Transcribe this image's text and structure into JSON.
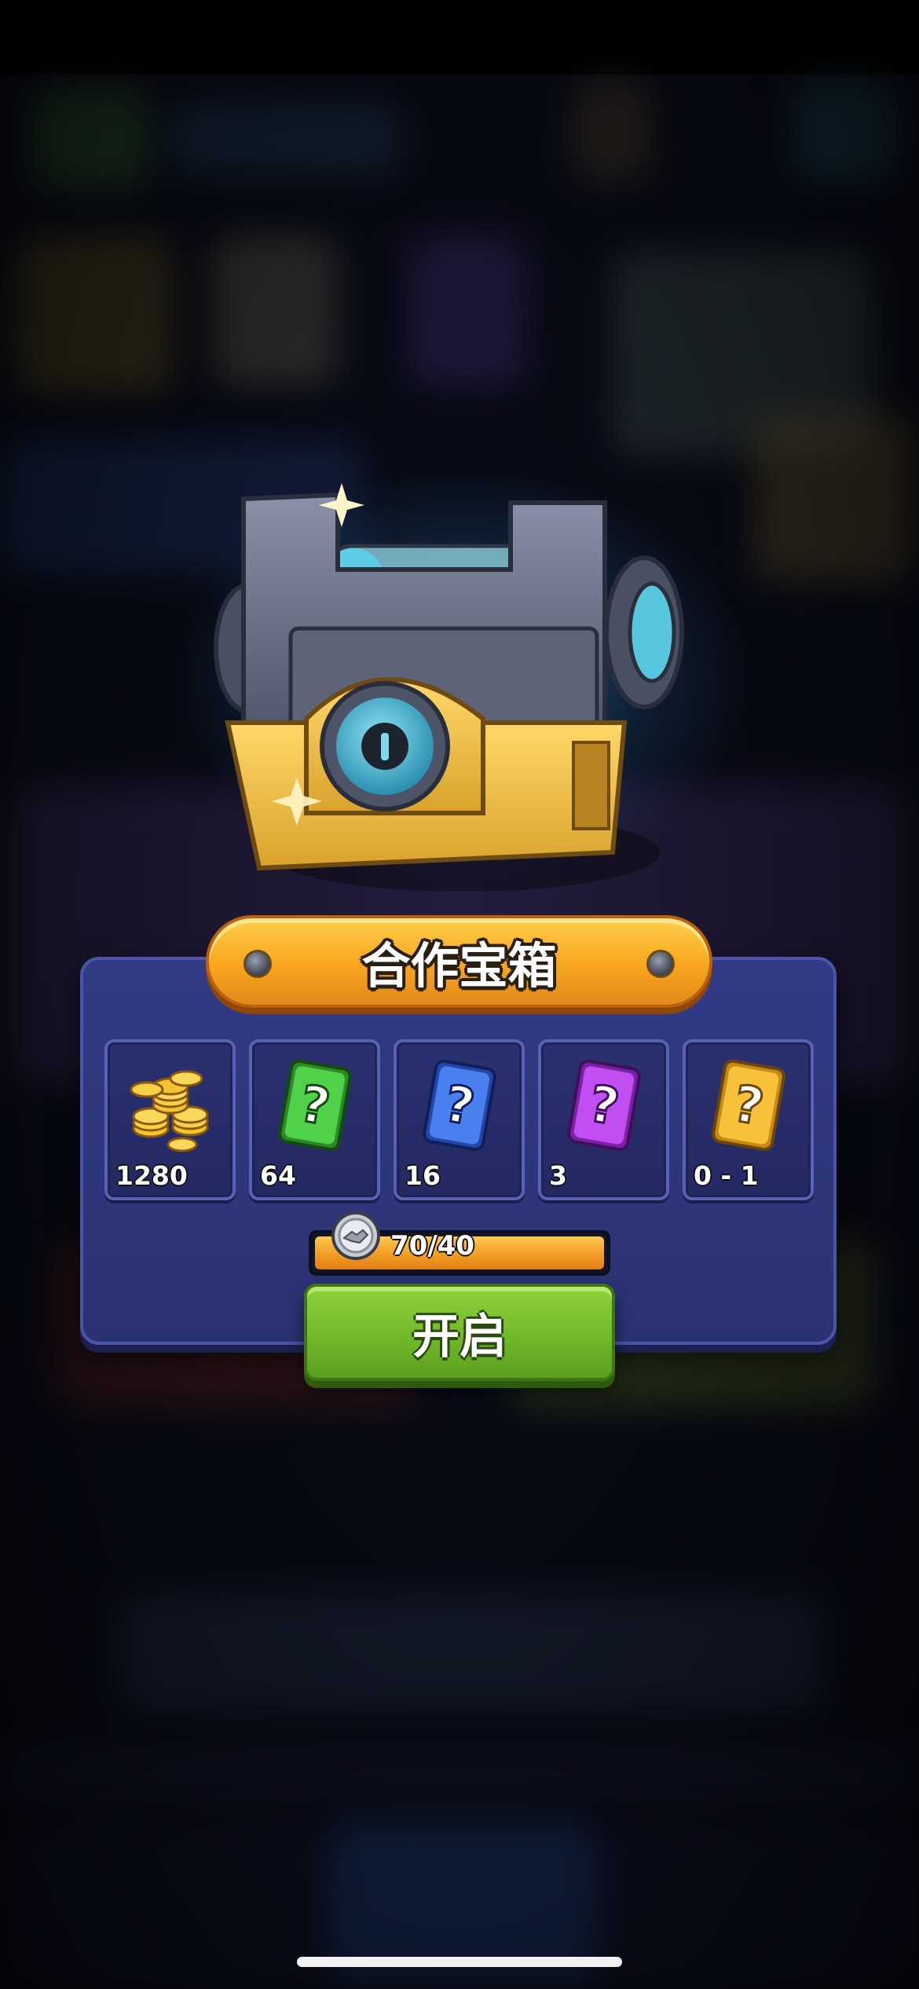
{
  "chest": {
    "title": "合作宝箱",
    "image": "cooperation-chest-icon"
  },
  "rewards": [
    {
      "icon": "gold-coins-icon",
      "amount": "1280",
      "color": "#f4c430"
    },
    {
      "icon": "green-card-icon",
      "amount": "64",
      "color": "#3fc23a"
    },
    {
      "icon": "blue-card-icon",
      "amount": "16",
      "color": "#3a6ef0"
    },
    {
      "icon": "purple-card-icon",
      "amount": "3",
      "color": "#b33ee8"
    },
    {
      "icon": "gold-card-icon",
      "amount": "0 - 1",
      "color": "#f3b21f"
    }
  ],
  "progress": {
    "icon": "handshake-coin-icon",
    "label": "70/40",
    "fraction": 1.0
  },
  "open_button": {
    "label": "开启"
  },
  "colors": {
    "panel": "#2f367a",
    "banner": "#f7a51f",
    "button": "#72b92a"
  }
}
